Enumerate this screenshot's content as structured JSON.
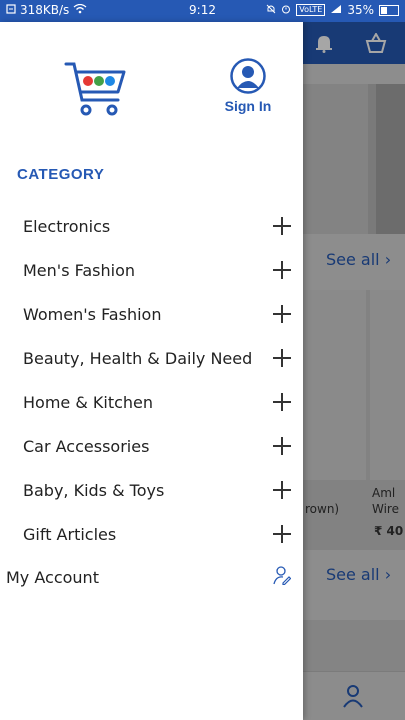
{
  "status_bar": {
    "network_speed": "318KB/s",
    "time": "9:12",
    "volte": "VoLTE",
    "battery": "35%"
  },
  "drawer": {
    "sign_in_label": "Sign In",
    "category_title": "CATEGORY",
    "categories": [
      {
        "label": "Electronics"
      },
      {
        "label": "Men's Fashion"
      },
      {
        "label": "Women's Fashion"
      },
      {
        "label": "Beauty, Health & Daily Need"
      },
      {
        "label": "Home & Kitchen"
      },
      {
        "label": "Car Accessories"
      },
      {
        "label": "Baby, Kids & Toys"
      },
      {
        "label": "Gift Articles"
      }
    ],
    "my_account_label": "My Account"
  },
  "background": {
    "see_all_1": "See all",
    "see_all_2": "See all",
    "card_text_1": "rown)",
    "card_text_2": "Aml",
    "card_text_3": "Wire",
    "card_price": "₹ 40"
  },
  "colors": {
    "brand": "#2659b4"
  }
}
